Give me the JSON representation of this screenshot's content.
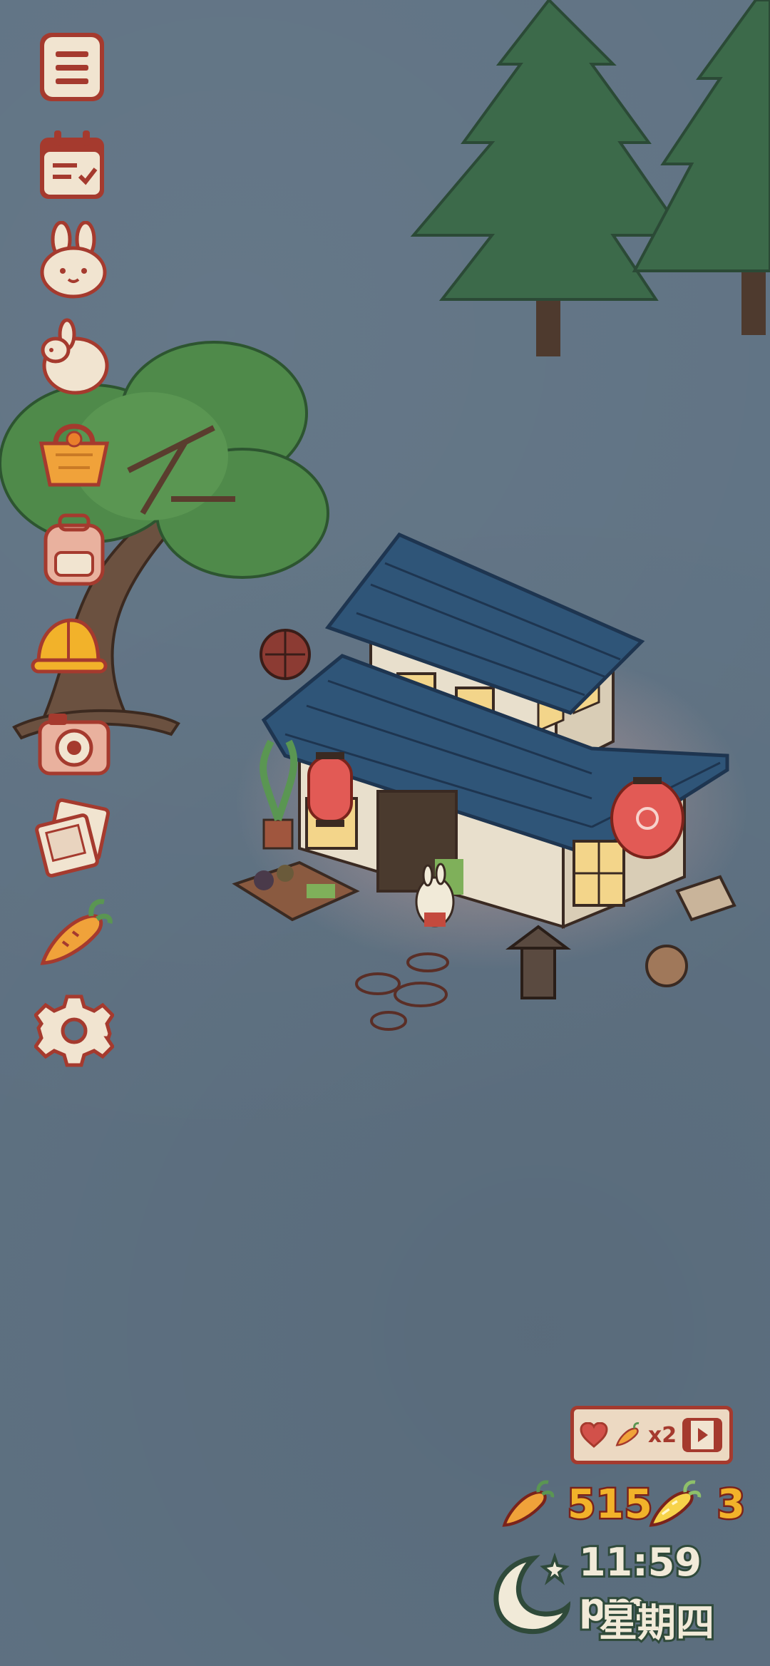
{
  "hud": {
    "carrots": "515",
    "golden_carrots": "3",
    "ad_multiplier": "x2",
    "time": "11:59 pm",
    "weekday": "星期四"
  },
  "menu": {
    "items": [
      {
        "icon": "menu-list-icon"
      },
      {
        "icon": "calendar-checklist-icon"
      },
      {
        "icon": "bunny-face-icon"
      },
      {
        "icon": "bunny-sitting-icon"
      },
      {
        "icon": "shopping-basket-icon"
      },
      {
        "icon": "backpack-icon"
      },
      {
        "icon": "hard-hat-icon"
      },
      {
        "icon": "camera-icon"
      },
      {
        "icon": "photo-album-icon"
      },
      {
        "icon": "carrot-icon"
      },
      {
        "icon": "settings-gear-icon"
      }
    ]
  },
  "colors": {
    "background": "#5f7283",
    "accent_red": "#a53a2e",
    "cream": "#f1e4d0",
    "carrot_orange": "#f0a23a",
    "gold": "#f2b22a",
    "roof_blue": "#2f5578",
    "tree_green": "#3d6b45"
  }
}
